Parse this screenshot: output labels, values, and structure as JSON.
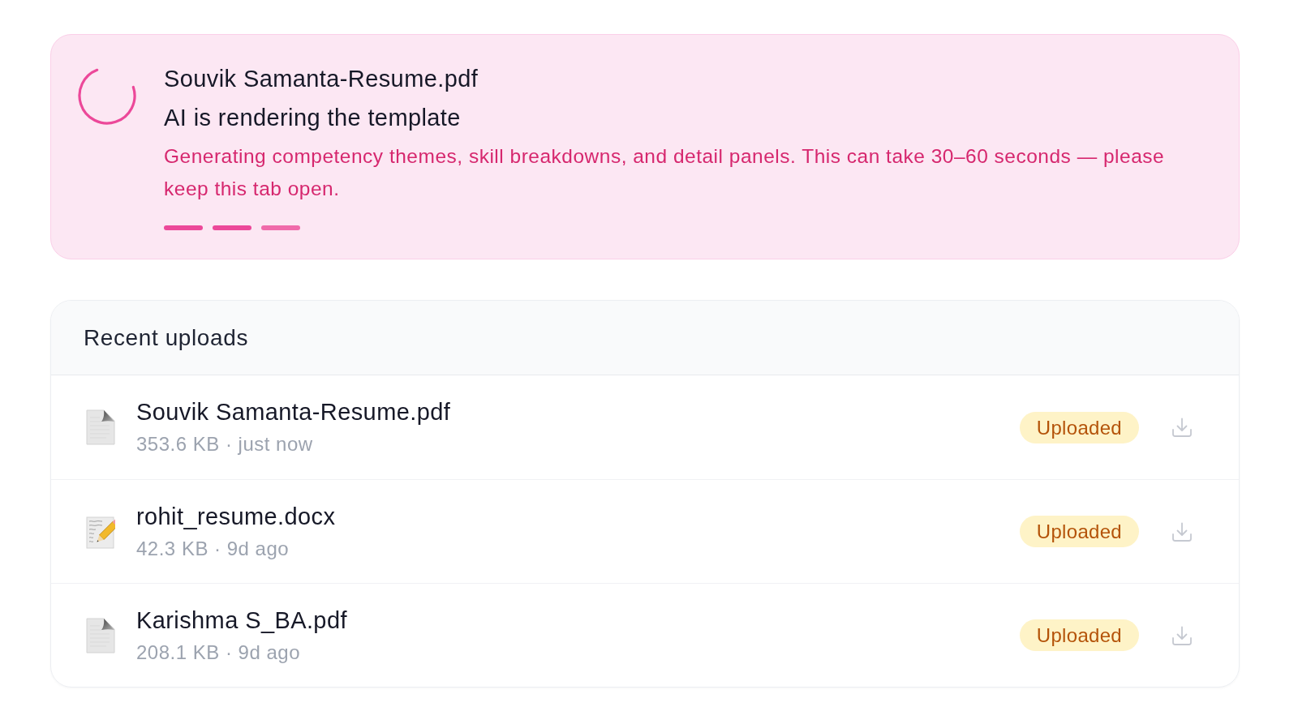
{
  "processing_card": {
    "file_name": "Souvik Samanta-Resume.pdf",
    "status": "AI is rendering the template",
    "message": "Generating competency themes, skill breakdowns, and detail panels. This can take 30–60 seconds — please keep this tab open."
  },
  "recent_uploads": {
    "title": "Recent uploads",
    "items": [
      {
        "kind": "generic",
        "name": "Souvik Samanta-Resume.pdf",
        "meta": "353.6 KB · just now",
        "status": "Uploaded"
      },
      {
        "kind": "text",
        "name": "rohit_resume.docx",
        "meta": "42.3 KB · 9d ago",
        "status": "Uploaded"
      },
      {
        "kind": "generic",
        "name": "Karishma S_BA.pdf",
        "meta": "208.1 KB · 9d ago",
        "status": "Uploaded"
      }
    ]
  }
}
